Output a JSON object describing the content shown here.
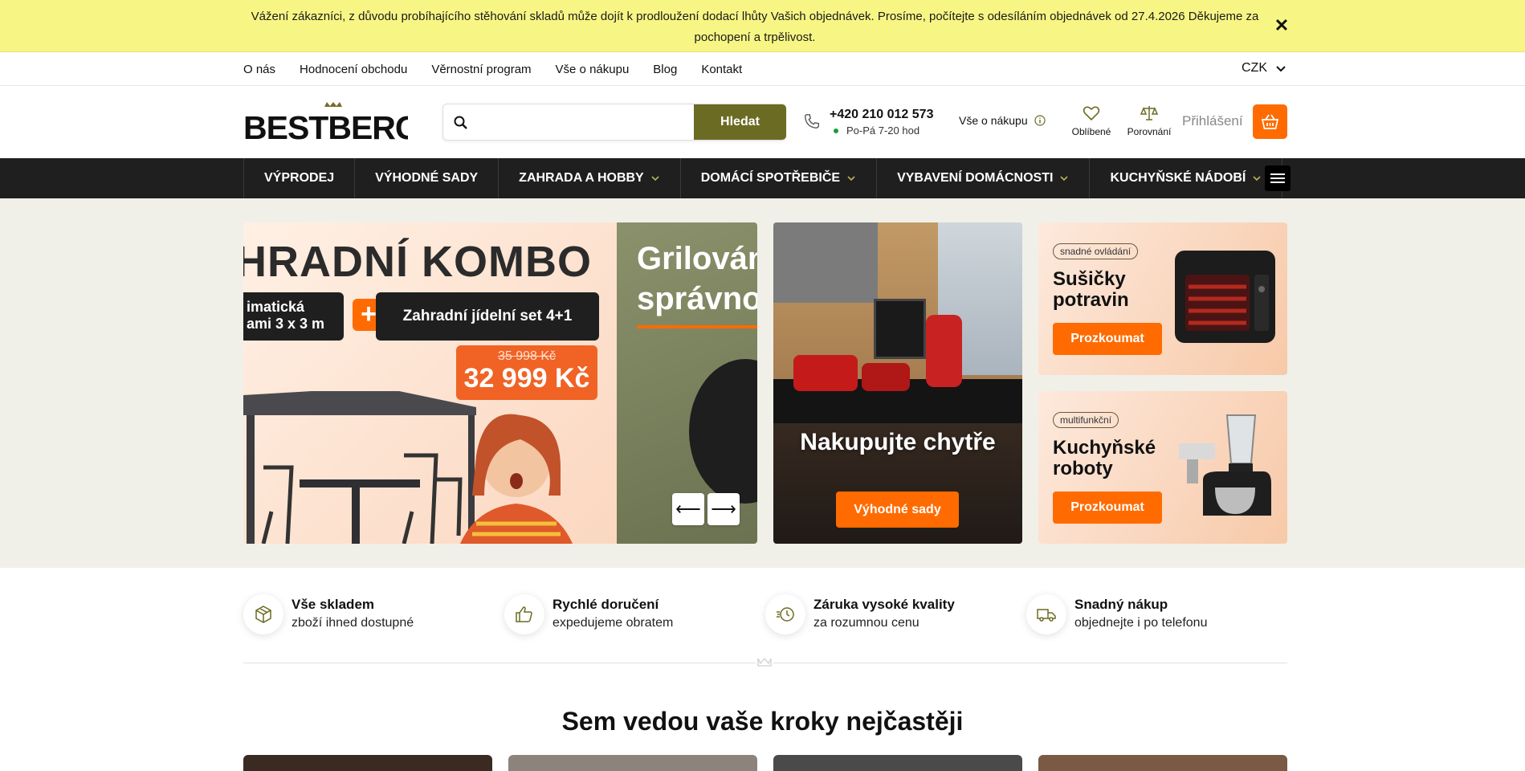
{
  "notice": {
    "text": "Vážení zákazníci, z důvodu probíhajícího stěhování skladů může dojít k prodloužení dodací lhůty Vašich objednávek. Prosíme, počítejte s odesíláním objednávek od 27.4.2026 Děkujeme za pochopení a trpělivost.",
    "close_icon": "close-icon"
  },
  "toplinks": [
    "O nás",
    "Hodnocení obchodu",
    "Věrnostní program",
    "Vše o nákupu",
    "Blog",
    "Kontakt"
  ],
  "currency": "CZK",
  "header": {
    "logo": "BESTBERG",
    "search_button": "Hledat",
    "search_placeholder": "",
    "phone": "+420 210 012 573",
    "hours": "Po-Pá 7-20 hod",
    "all_about_buying": "Vše o nákupu",
    "favorites": "Oblíbené",
    "compare": "Porovnání",
    "login": "Přihlášení"
  },
  "nav": {
    "items": [
      {
        "label": "VÝPRODEJ",
        "dropdown": false
      },
      {
        "label": "VÝHODNÉ SADY",
        "dropdown": false
      },
      {
        "label": "ZAHRADA A HOBBY",
        "dropdown": true
      },
      {
        "label": "DOMÁCÍ SPOTŘEBIČE",
        "dropdown": true
      },
      {
        "label": "VYBAVENÍ DOMÁCNOSTI",
        "dropdown": true
      },
      {
        "label": "KUCHYŇSKÉ NÁDOBÍ",
        "dropdown": true
      }
    ]
  },
  "slider": {
    "slide1": {
      "title": "HRADNÍ KOMBO",
      "chip1": "imatická\nami 3 x 3 m",
      "plus": "+",
      "chip2": "Zahradní jídelní set 4+1",
      "old_price": "35 998 Kč",
      "new_price": "32 999 Kč"
    },
    "slide2": {
      "title": "Grilován\nsprávno"
    },
    "prev": "⟵",
    "next": "⟶"
  },
  "kitchen_banner": {
    "title": "Nakupujte chytře",
    "button": "Výhodné sady"
  },
  "promos": [
    {
      "tag": "snadné ovládání",
      "title": "Sušičky potravin",
      "button": "Prozkoumat"
    },
    {
      "tag": "multifunkční",
      "title": "Kuchyňské roboty",
      "button": "Prozkoumat"
    }
  ],
  "features": [
    {
      "title": "Vše skladem",
      "subtitle": "zboží ihned dostupné",
      "icon": "box-icon"
    },
    {
      "title": "Rychlé doručení",
      "subtitle": "expedujeme obratem",
      "icon": "thumbs-up-icon"
    },
    {
      "title": "Záruka vysoké kvality",
      "subtitle": "za rozumnou cenu",
      "icon": "fast-clock-icon"
    },
    {
      "title": "Snadný nákup",
      "subtitle": "objednejte i po telefonu",
      "icon": "truck-icon"
    }
  ],
  "section_title": "Sem vedou vaše kroky nejčastěji",
  "colors": {
    "notice_bg": "#f7f685",
    "accent": "#ff6b00",
    "olive": "#6b6b23",
    "nav_bg": "#1f1f1f"
  }
}
